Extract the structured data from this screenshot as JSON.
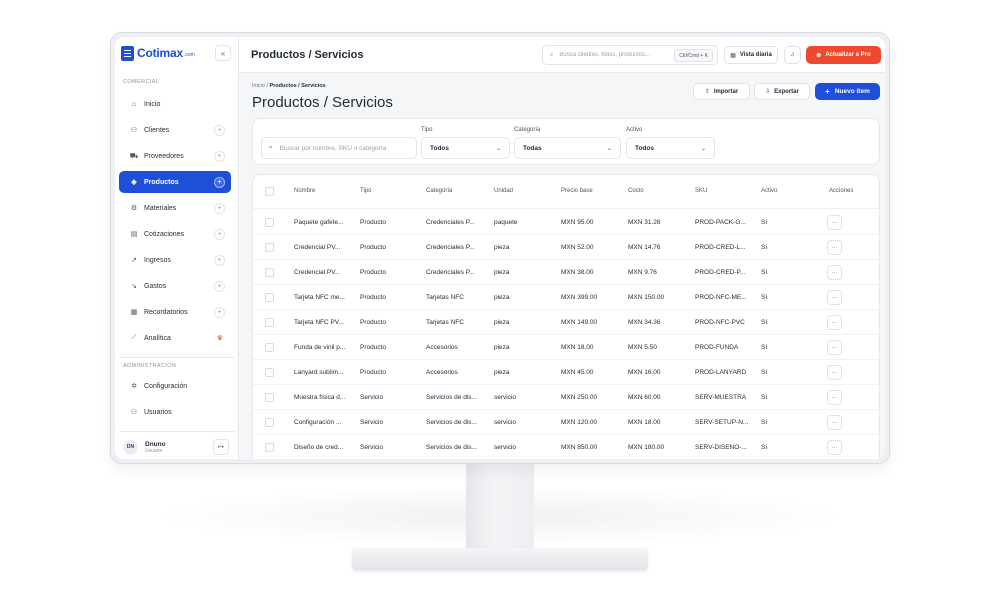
{
  "app": {
    "logo": "Cotimax",
    "logo_suffix": ".com",
    "collapse_icon": "«"
  },
  "sidebar": {
    "section_comercial": "COMERCIAL",
    "section_admin": "ADMINISTRACION",
    "items": [
      {
        "label": "Inicio",
        "icon": "home-icon",
        "glyph": "⌂"
      },
      {
        "label": "Clientes",
        "icon": "users-icon",
        "glyph": "⚇"
      },
      {
        "label": "Proveedores",
        "icon": "truck-icon",
        "glyph": "⛟"
      },
      {
        "label": "Productos",
        "icon": "box-icon",
        "glyph": "◈"
      },
      {
        "label": "Materiales",
        "icon": "layers-icon",
        "glyph": "⚙"
      },
      {
        "label": "Cotizaciones",
        "icon": "document-icon",
        "glyph": "▤"
      },
      {
        "label": "Ingresos",
        "icon": "trend-up-icon",
        "glyph": "↗"
      },
      {
        "label": "Gastos",
        "icon": "trend-down-icon",
        "glyph": "↘"
      },
      {
        "label": "Recordatorios",
        "icon": "calendar-icon",
        "glyph": "▦"
      },
      {
        "label": "Analítica",
        "icon": "chart-icon",
        "glyph": "⟋"
      }
    ],
    "admin_items": [
      {
        "label": "Configuración",
        "icon": "gear-icon",
        "glyph": "✲"
      },
      {
        "label": "Usuarios",
        "icon": "team-icon",
        "glyph": "⚇"
      }
    ],
    "plus": "+",
    "pro_badge": "♛",
    "user": {
      "initials": "DN",
      "name": "Dnuno",
      "role": "Usuario",
      "logout_glyph": "↦"
    }
  },
  "topbar": {
    "title": "Productos / Servicios",
    "search_placeholder": "Busca clientes, folios, productos...",
    "search_glyph": "⌕",
    "shortcut": "Ctrl/Cmd + K",
    "vista_diaria": "Vista diaria",
    "vista_glyph": "▦",
    "bell_glyph": "♫",
    "upgrade": "Actualizar a Pro",
    "upgrade_glyph": "⊛"
  },
  "page": {
    "breadcrumb_root": "Inicio /",
    "breadcrumb_current": "Productos / Servicios",
    "title": "Productos / Servicios",
    "import": "Importar",
    "import_glyph": "⇧",
    "export": "Exportar",
    "export_glyph": "⇩",
    "new_item": "Nuevo ítem",
    "new_glyph": "+"
  },
  "filters": {
    "search_placeholder": "Buscar por nombre, SKU o categoría",
    "search_glyph": "⌕",
    "tipo_label": "Tipo",
    "tipo_value": "Todos",
    "categoria_label": "Categoría",
    "categoria_value": "Todas",
    "activo_label": "Activo",
    "activo_value": "Todos",
    "chevron": "⌄"
  },
  "table": {
    "columns": [
      "Nombre",
      "Tipo",
      "Categoría",
      "Unidad",
      "Precio base",
      "Costo",
      "SKU",
      "Activo",
      "Acciones"
    ],
    "action_glyph": "···",
    "rows": [
      {
        "nombre": "Paquete gafete...",
        "tipo": "Producto",
        "categoria": "Credenciales P...",
        "unidad": "paquete",
        "precio": "MXN 95.00",
        "costo": "MXN 31.26",
        "sku": "PROD-PACK-G...",
        "activo": "Sí"
      },
      {
        "nombre": "Credencial PV...",
        "tipo": "Producto",
        "categoria": "Credenciales P...",
        "unidad": "pieza",
        "precio": "MXN 52.00",
        "costo": "MXN 14.76",
        "sku": "PROD-CRED-L...",
        "activo": "Sí"
      },
      {
        "nombre": "Credencial PV...",
        "tipo": "Producto",
        "categoria": "Credenciales P...",
        "unidad": "pieza",
        "precio": "MXN 38.00",
        "costo": "MXN 9.76",
        "sku": "PROD-CRED-P...",
        "activo": "Sí"
      },
      {
        "nombre": "Tarjeta NFC me...",
        "tipo": "Producto",
        "categoria": "Tarjetas NFC",
        "unidad": "pieza",
        "precio": "MXN 399.00",
        "costo": "MXN 150.00",
        "sku": "PROD-NFC-ME...",
        "activo": "Sí"
      },
      {
        "nombre": "Tarjeta NFC PV...",
        "tipo": "Producto",
        "categoria": "Tarjetas NFC",
        "unidad": "pieza",
        "precio": "MXN 149.00",
        "costo": "MXN 34.36",
        "sku": "PROD-NFC-PVC",
        "activo": "Sí"
      },
      {
        "nombre": "Funda de vinil p...",
        "tipo": "Producto",
        "categoria": "Accesorios",
        "unidad": "pieza",
        "precio": "MXN 18.00",
        "costo": "MXN 5.50",
        "sku": "PROD-FUNDA",
        "activo": "Sí"
      },
      {
        "nombre": "Lanyard sublim...",
        "tipo": "Producto",
        "categoria": "Accesorios",
        "unidad": "pieza",
        "precio": "MXN 45.00",
        "costo": "MXN 16.00",
        "sku": "PROD-LANYARD",
        "activo": "Sí"
      },
      {
        "nombre": "Muestra física d...",
        "tipo": "Servicio",
        "categoria": "Servicios de dis...",
        "unidad": "servicio",
        "precio": "MXN 250.00",
        "costo": "MXN 60.00",
        "sku": "SERV-MUESTRA",
        "activo": "Sí"
      },
      {
        "nombre": "Configuración ...",
        "tipo": "Servicio",
        "categoria": "Servicios de dis...",
        "unidad": "servicio",
        "precio": "MXN 120.00",
        "costo": "MXN 18.00",
        "sku": "SERV-SETUP-N...",
        "activo": "Sí"
      },
      {
        "nombre": "Diseño de cred...",
        "tipo": "Servicio",
        "categoria": "Servicios de dis...",
        "unidad": "servicio",
        "precio": "MXN 850.00",
        "costo": "MXN 180.00",
        "sku": "SERV-DISENO-...",
        "activo": "Sí"
      }
    ]
  },
  "colors": {
    "primary": "#1d4fd7",
    "upgrade": "#ef4a2e",
    "pro_badge": "#ef4a2e"
  }
}
